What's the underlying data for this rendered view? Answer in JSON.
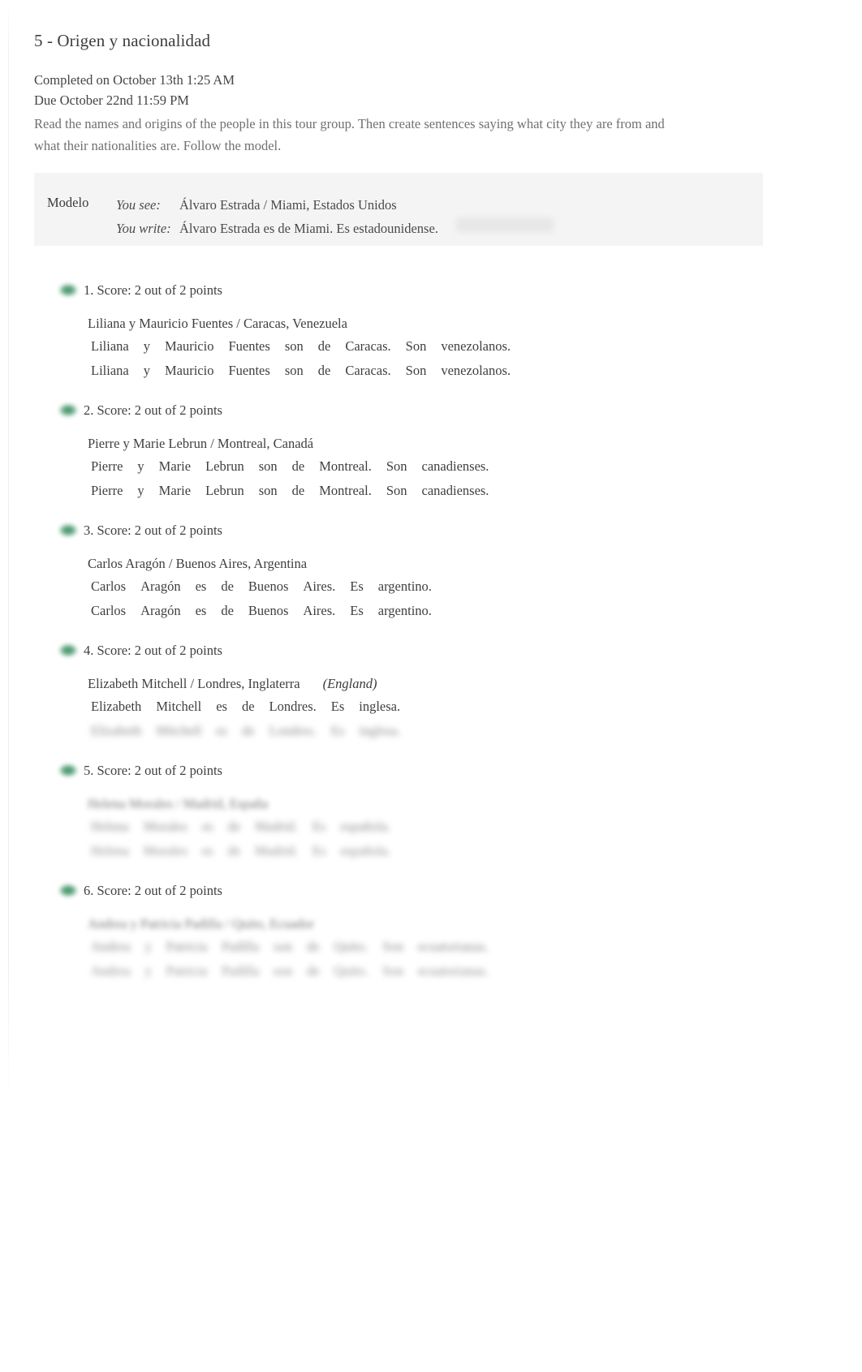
{
  "assignment": {
    "title": "5 - Origen y nacionalidad",
    "completed": "Completed on October 13th 1:25 AM",
    "due": "Due October 22nd 11:59 PM",
    "instructions": "Read the names and origins of the people in this tour group. Then create sentences saying what city they are from and what their nationalities are. Follow the model."
  },
  "modelo": {
    "label": "Modelo",
    "see_cue": "You see:",
    "see_text": "Álvaro Estrada / Miami, Estados Unidos",
    "write_cue": "You write:",
    "write_text": "Álvaro Estrada es de Miami. Es estadounidense."
  },
  "status_colors": {
    "correct_green": "#3f8f65",
    "modelo_background": "#f4f4f4",
    "body_text": "#3f3f3f",
    "muted_text": "#707070"
  },
  "items": [
    {
      "number": "1.",
      "score": "1. Score: 2 out of 2 points",
      "icon": "check-circle-icon",
      "prompt": "Liliana y Mauricio Fuentes / Caracas, Venezuela",
      "hint": "",
      "answer_tokens": [
        "Liliana",
        "y",
        "Mauricio",
        "Fuentes",
        "son",
        "de",
        "Caracas.",
        "Son",
        "venezolanos."
      ],
      "correct_tokens": [
        "Liliana",
        "y",
        "Mauricio",
        "Fuentes",
        "son",
        "de",
        "Caracas.",
        "Son",
        "venezolanos."
      ],
      "blur": "none"
    },
    {
      "number": "2.",
      "score": "2. Score: 2 out of 2 points",
      "icon": "check-circle-icon",
      "prompt": "Pierre y Marie Lebrun / Montreal, Canadá",
      "hint": "",
      "answer_tokens": [
        "Pierre",
        "y",
        "Marie",
        "Lebrun",
        "son",
        "de",
        "Montreal.",
        "Son",
        "canadienses."
      ],
      "correct_tokens": [
        "Pierre",
        "y",
        "Marie",
        "Lebrun",
        "son",
        "de",
        "Montreal.",
        "Son",
        "canadienses."
      ],
      "blur": "none"
    },
    {
      "number": "3.",
      "score": "3. Score: 2 out of 2 points",
      "icon": "check-circle-icon",
      "prompt": "Carlos Aragón / Buenos Aires, Argentina",
      "hint": "",
      "answer_tokens": [
        "Carlos",
        "Aragón",
        "es",
        "de",
        "Buenos",
        "Aires.",
        "Es",
        "argentino."
      ],
      "correct_tokens": [
        "Carlos",
        "Aragón",
        "es",
        "de",
        "Buenos",
        "Aires.",
        "Es",
        "argentino."
      ],
      "blur": "none"
    },
    {
      "number": "4.",
      "score": "4. Score: 2 out of 2 points",
      "icon": "check-circle-icon",
      "prompt": "Elizabeth Mitchell / Londres, Inglaterra",
      "hint": "(England)",
      "answer_tokens": [
        "Elizabeth",
        "Mitchell",
        "es",
        "de",
        "Londres.",
        "Es",
        "inglesa."
      ],
      "correct_tokens": [
        "Elizabeth",
        "Mitchell",
        "es",
        "de",
        "Londres.",
        "Es",
        "inglesa."
      ],
      "blur": "second-line"
    },
    {
      "number": "5.",
      "score": "5. Score: 2 out of 2 points",
      "icon": "check-circle-icon",
      "prompt": "Helena Morales / Madrid, España",
      "hint": "",
      "answer_tokens": [
        "Helena",
        "Morales",
        "es",
        "de",
        "Madrid.",
        "Es",
        "española."
      ],
      "correct_tokens": [
        "Helena",
        "Morales",
        "es",
        "de",
        "Madrid.",
        "Es",
        "española."
      ],
      "blur": "all"
    },
    {
      "number": "6.",
      "score": "6. Score: 2 out of 2 points",
      "icon": "check-circle-icon",
      "prompt": "Andrea y Patricia Padilla / Quito, Ecuador",
      "hint": "",
      "answer_tokens": [
        "Andrea",
        "y",
        "Patricia",
        "Padilla",
        "son",
        "de",
        "Quito.",
        "Son",
        "ecuatorianas."
      ],
      "correct_tokens": [
        "Andrea",
        "y",
        "Patricia",
        "Padilla",
        "son",
        "de",
        "Quito.",
        "Son",
        "ecuatorianas."
      ],
      "blur": "all"
    }
  ]
}
